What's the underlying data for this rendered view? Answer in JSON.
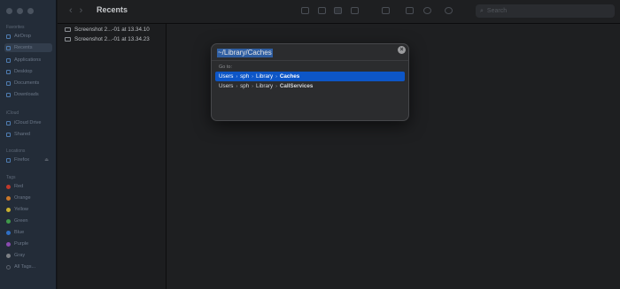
{
  "window": {
    "title": "Recents"
  },
  "sidebar": {
    "sections": [
      {
        "title": "Favorites",
        "items": [
          {
            "label": "AirDrop",
            "icon": "airdrop-icon"
          },
          {
            "label": "Recents",
            "icon": "clock-icon",
            "selected": true
          },
          {
            "label": "Applications",
            "icon": "applications-icon"
          },
          {
            "label": "Desktop",
            "icon": "desktop-icon"
          },
          {
            "label": "Documents",
            "icon": "document-icon"
          },
          {
            "label": "Downloads",
            "icon": "download-icon"
          }
        ]
      },
      {
        "title": "iCloud",
        "items": [
          {
            "label": "iCloud Drive",
            "icon": "cloud-icon"
          },
          {
            "label": "Shared",
            "icon": "shared-folder-icon"
          }
        ]
      },
      {
        "title": "Locations",
        "items": [
          {
            "label": "Firefox",
            "icon": "disk-icon",
            "eject": "⏏"
          }
        ]
      },
      {
        "title": "Tags",
        "tags": [
          {
            "label": "Red",
            "color": "#c0392b"
          },
          {
            "label": "Orange",
            "color": "#c9772a"
          },
          {
            "label": "Yellow",
            "color": "#c8b030"
          },
          {
            "label": "Green",
            "color": "#3f9a4a"
          },
          {
            "label": "Blue",
            "color": "#2f6fc4"
          },
          {
            "label": "Purple",
            "color": "#8a4bb0"
          },
          {
            "label": "Gray",
            "color": "#7d8085"
          },
          {
            "label": "All Tags...",
            "color": "none"
          }
        ]
      }
    ]
  },
  "toolbar": {
    "back": "‹",
    "forward": "›",
    "search_placeholder": "Search"
  },
  "files": [
    {
      "name": "Screenshot 2...-01 at 13.34.10"
    },
    {
      "name": "Screenshot 2...-01 at 13.34.23"
    }
  ],
  "dialog": {
    "path_value": "~/Library/Caches",
    "clear_label": "×",
    "goto_label": "Go to:",
    "suggestions": [
      {
        "parts": [
          "Users",
          "sph",
          "Library"
        ],
        "last": "Caches",
        "selected": true
      },
      {
        "parts": [
          "Users",
          "sph",
          "Library"
        ],
        "last": "CallServices",
        "selected": false
      }
    ],
    "separator": "›"
  },
  "colors": {
    "selection": "#0d56c7",
    "sidebar_bg": "#232c38",
    "window_bg": "#1e1f21"
  }
}
